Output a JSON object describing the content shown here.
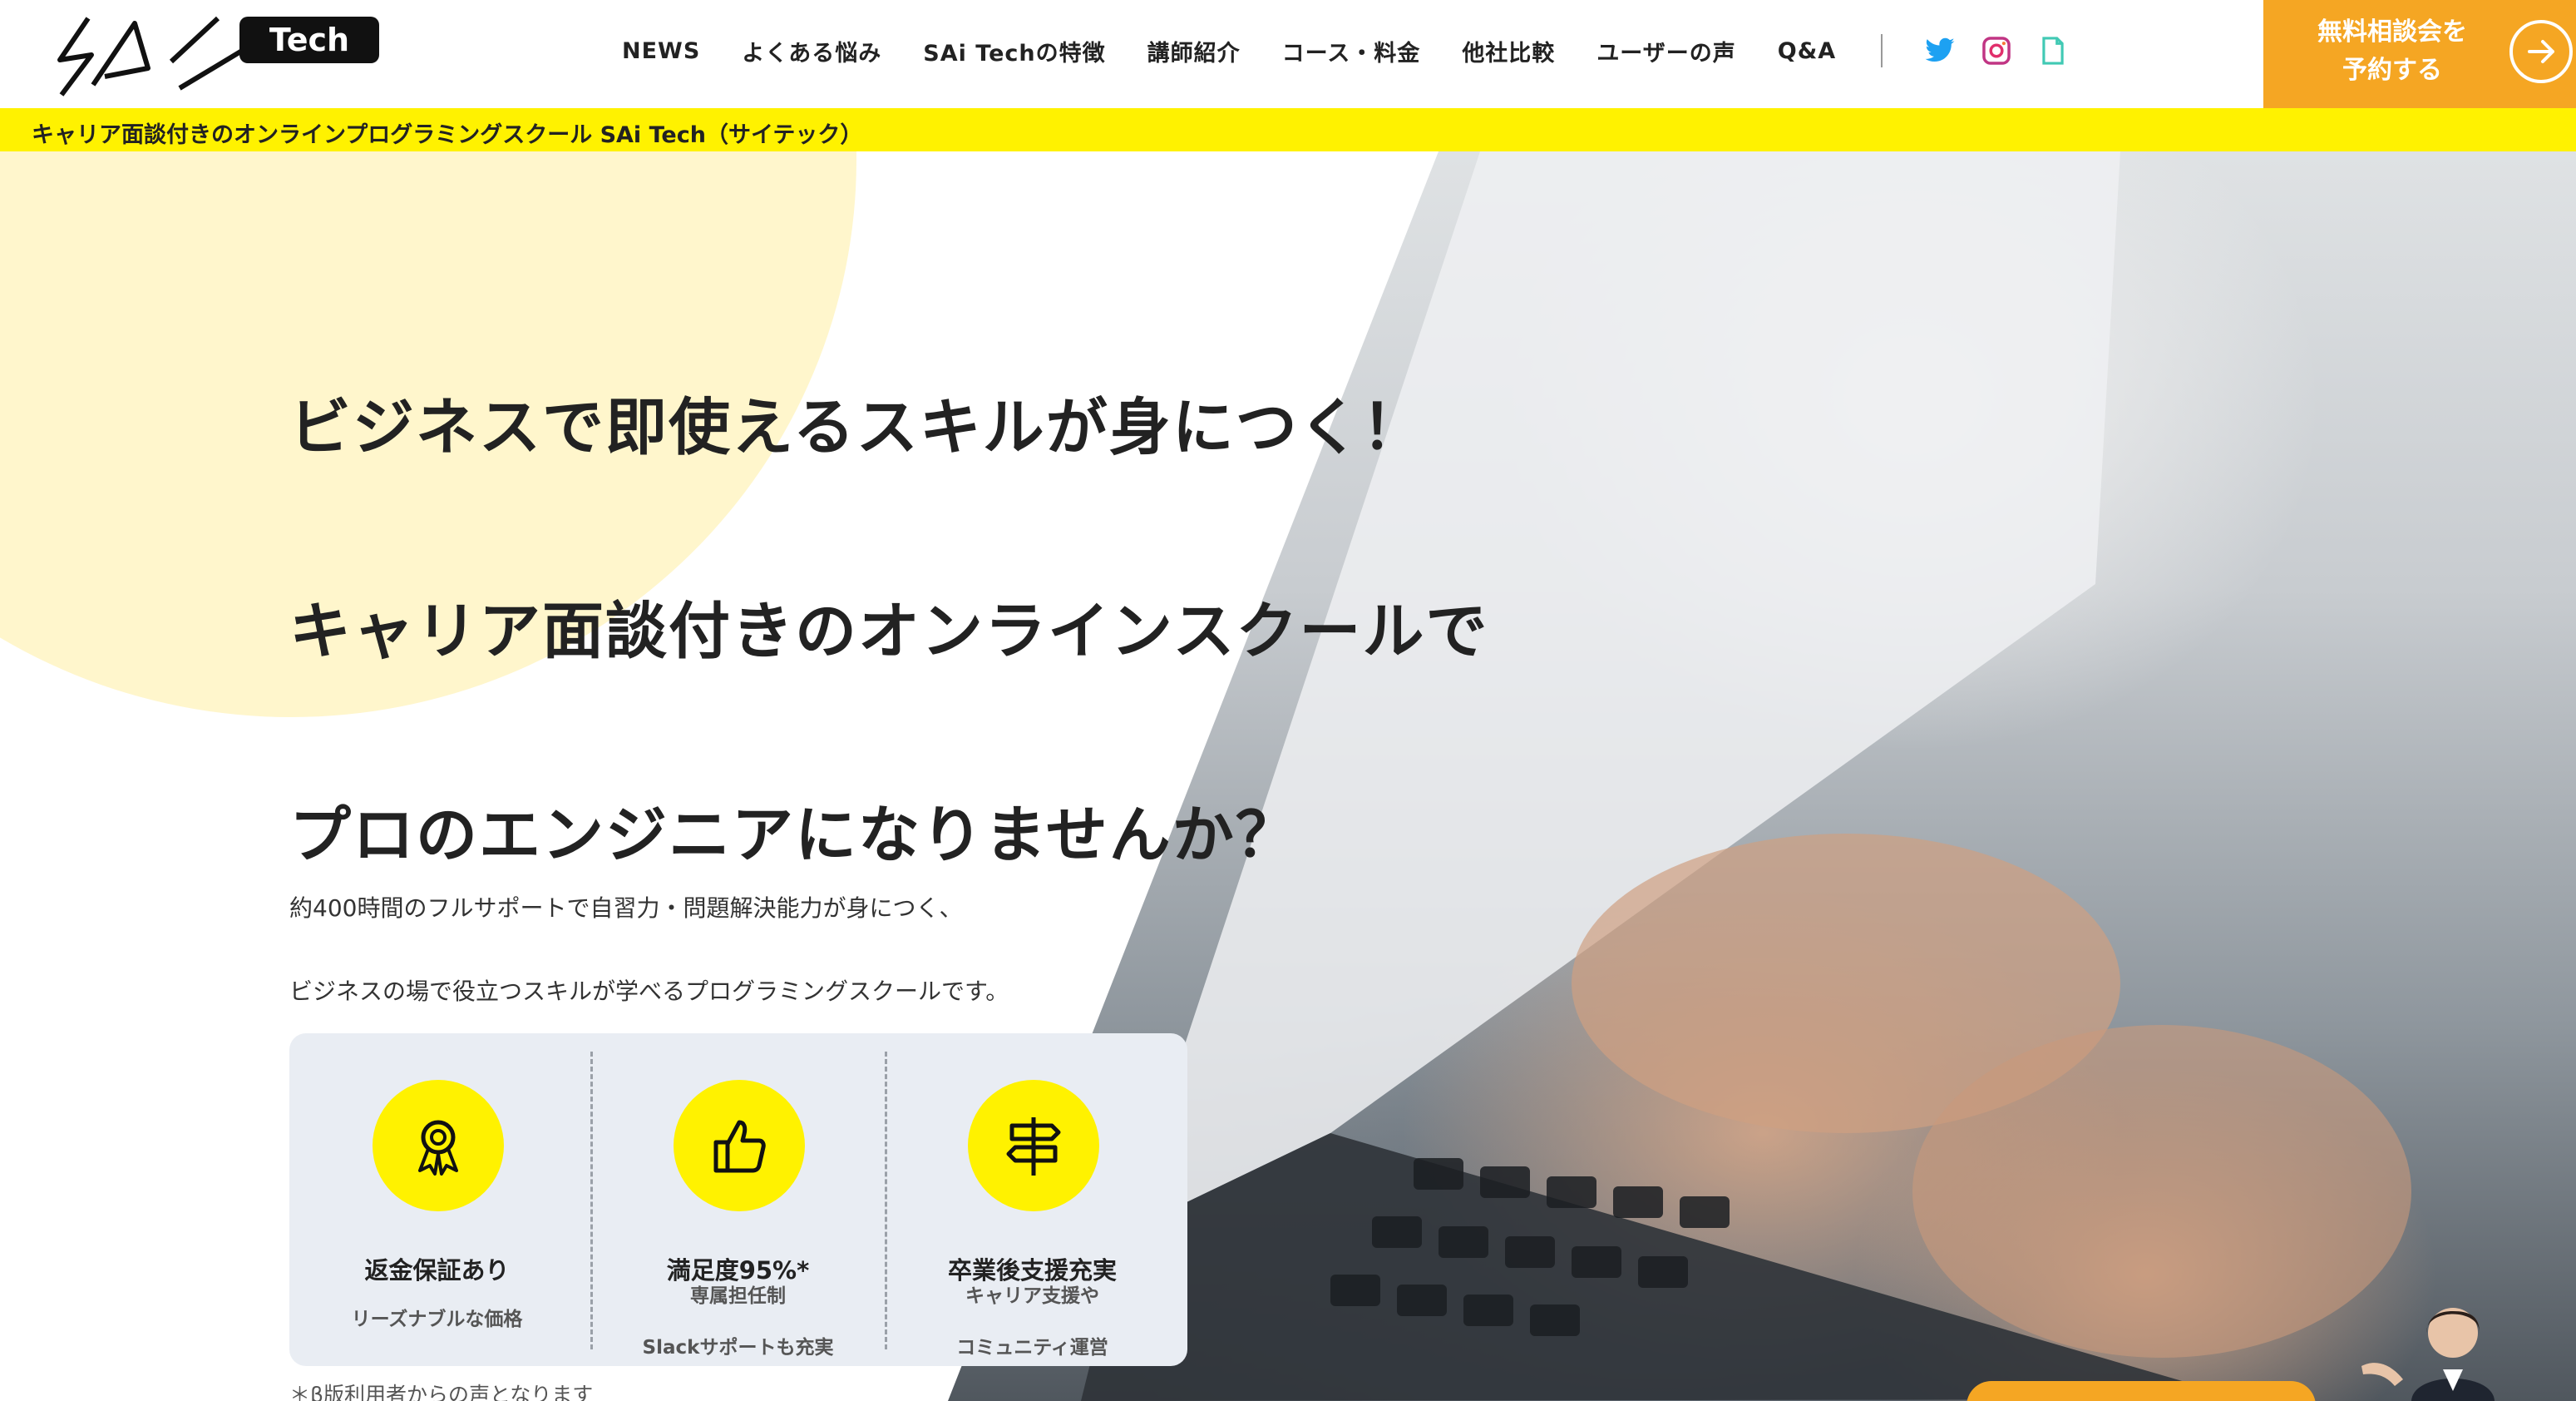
{
  "header": {
    "logo_text": "Tech",
    "nav": [
      "NEWS",
      "よくある悩み",
      "SAi Techの特徴",
      "講師紹介",
      "コース・料金",
      "他社比較",
      "ユーザーの声",
      "Q&A"
    ],
    "social_icons": [
      "twitter-icon",
      "instagram-icon",
      "note-icon"
    ],
    "cta_label": "無料相談会を\n予約する",
    "colors": {
      "accent": "#f5a623",
      "brand_yellow": "#fff200"
    }
  },
  "strip": {
    "text": "キャリア面談付きのオンラインプログラミングスクール SAi Tech（サイテック）"
  },
  "hero": {
    "headline": [
      "ビジネスで即使えるスキルが身につく！",
      "キャリア面談付きのオンラインスクールで",
      "プロのエンジニアになりませんか？"
    ],
    "sub": [
      "約400時間のフルサポートで自習力・問題解決能力が身につく、",
      "ビジネスの場で役立つスキルが学べるプログラミングスクールです。"
    ],
    "features": [
      {
        "icon": "award-ribbon-icon",
        "title": "返金保証あり",
        "notes": [
          "リーズナブルな価格"
        ]
      },
      {
        "icon": "thumbs-up-icon",
        "title": "満足度95%*",
        "notes": [
          "専属担任制",
          "Slackサポートも充実"
        ]
      },
      {
        "icon": "signpost-icon",
        "title": "卒業後支援充実",
        "notes": [
          "キャリア支援や",
          "コミュニティ運営"
        ]
      }
    ],
    "footnote": "＊β版利用者からの声となります"
  }
}
